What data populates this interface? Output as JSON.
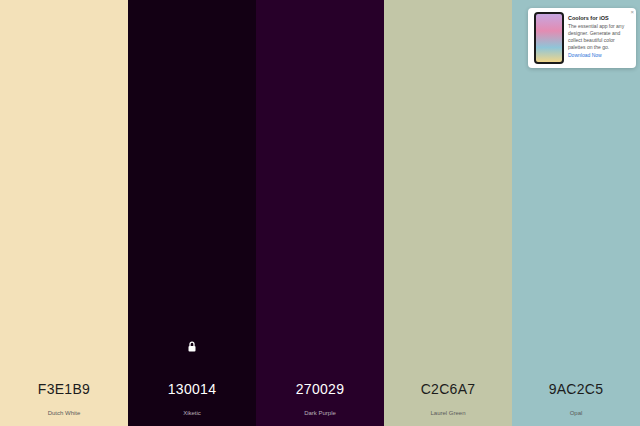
{
  "palette": [
    {
      "hex": "F3E1B9",
      "name": "Dutch White",
      "color": "#F3E1B9",
      "locked": false
    },
    {
      "hex": "130014",
      "name": "Xiketic",
      "color": "#130014",
      "locked": true
    },
    {
      "hex": "270029",
      "name": "Dark Purple",
      "color": "#270029",
      "locked": false
    },
    {
      "hex": "C2C6A7",
      "name": "Laurel Green",
      "color": "#C2C6A7",
      "locked": false
    },
    {
      "hex": "9AC2C5",
      "name": "Opal",
      "color": "#9AC2C5",
      "locked": false
    }
  ],
  "ad": {
    "title": "Coolors for iOS",
    "body": "The essential app for any designer. Generate and collect beautiful color palettes on the go.",
    "link": "Download Now",
    "close": "×"
  }
}
